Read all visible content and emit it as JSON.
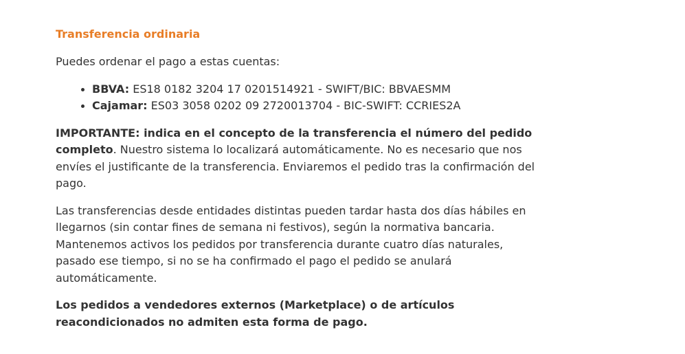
{
  "section": {
    "title": "Transferencia ordinaria",
    "intro": "Puedes ordenar el pago a estas cuentas:"
  },
  "accounts": [
    {
      "bank": "BBVA:",
      "details": " ES18 0182 3204 17 0201514921 - SWIFT/BIC: BBVAESMM"
    },
    {
      "bank": "Cajamar:",
      "details": " ES03 3058 0202 09 2720013704 - BIC-SWIFT: CCRIES2A"
    }
  ],
  "important": {
    "strong": "IMPORTANTE: indica en el concepto de la transferencia el número del pedido completo",
    "text": ". Nuestro sistema lo localizará automáticamente. No es necesario que nos envíes el justificante de la transferencia. Enviaremos el pedido tras la confirmación del pago."
  },
  "timing_text": "Las transferencias desde entidades distintas pueden tardar hasta dos días hábiles en llegarnos (sin contar fines de semana ni festivos), según la normativa bancaria. Mantenemos activos los pedidos por transferencia durante cuatro días naturales, pasado ese tiempo, si no se ha confirmado el pago el pedido se anulará automáticamente.",
  "marketplace_note": "Los pedidos a vendedores externos (Marketplace) o de artículos reacondicionados no admiten esta forma de pago.",
  "colors": {
    "title": "#e87d26",
    "text": "#333333",
    "background": "#ffffff"
  }
}
